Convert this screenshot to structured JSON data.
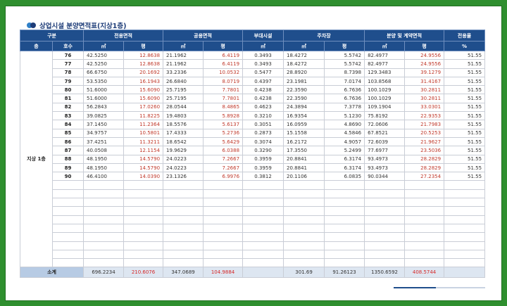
{
  "title": "상업시설 분양면적표(지상1층)",
  "headers": {
    "group": "구분",
    "exclusive": "전용면적",
    "common": "공용면적",
    "auxiliary": "부대시설",
    "parking": "주차장",
    "contract": "분양 및 계약면적",
    "ratio": "전용율",
    "floor": "층",
    "unit_no": "호수",
    "sqm": "㎡",
    "pyeong": "평",
    "percent": "%"
  },
  "floor_label": "지상 1층",
  "rows": [
    {
      "unit": "76",
      "ex_m": "42.5250",
      "ex_p": "12.8638",
      "co_m": "21.1962",
      "co_p": "6.4119",
      "aux": "0.3493",
      "pk_m": "18.4272",
      "pk_p": "5.5742",
      "ct_m": "82.4977",
      "ct_p": "24.9556",
      "ratio": "51.55"
    },
    {
      "unit": "77",
      "ex_m": "42.5250",
      "ex_p": "12.8638",
      "co_m": "21.1962",
      "co_p": "6.4119",
      "aux": "0.3493",
      "pk_m": "18.4272",
      "pk_p": "5.5742",
      "ct_m": "82.4977",
      "ct_p": "24.9556",
      "ratio": "51.55"
    },
    {
      "unit": "78",
      "ex_m": "66.6750",
      "ex_p": "20.1692",
      "co_m": "33.2336",
      "co_p": "10.0532",
      "aux": "0.5477",
      "pk_m": "28.8920",
      "pk_p": "8.7398",
      "ct_m": "129.3483",
      "ct_p": "39.1279",
      "ratio": "51.55"
    },
    {
      "unit": "79",
      "ex_m": "53.5350",
      "ex_p": "16.1943",
      "co_m": "26.6840",
      "co_p": "8.0719",
      "aux": "0.4397",
      "pk_m": "23.1981",
      "pk_p": "7.0174",
      "ct_m": "103.8568",
      "ct_p": "31.4167",
      "ratio": "51.55"
    },
    {
      "unit": "80",
      "ex_m": "51.6000",
      "ex_p": "15.6090",
      "co_m": "25.7195",
      "co_p": "7.7801",
      "aux": "0.4238",
      "pk_m": "22.3590",
      "pk_p": "6.7636",
      "ct_m": "100.1029",
      "ct_p": "30.2811",
      "ratio": "51.55"
    },
    {
      "unit": "81",
      "ex_m": "51.6000",
      "ex_p": "15.6090",
      "co_m": "25.7195",
      "co_p": "7.7801",
      "aux": "0.4238",
      "pk_m": "22.3590",
      "pk_p": "6.7636",
      "ct_m": "100.1029",
      "ct_p": "30.2811",
      "ratio": "51.55"
    },
    {
      "unit": "82",
      "ex_m": "56.2843",
      "ex_p": "17.0260",
      "co_m": "28.0544",
      "co_p": "8.4865",
      "aux": "0.4623",
      "pk_m": "24.3894",
      "pk_p": "7.3778",
      "ct_m": "109.1904",
      "ct_p": "33.0301",
      "ratio": "51.55"
    },
    {
      "unit": "83",
      "ex_m": "39.0825",
      "ex_p": "11.8225",
      "co_m": "19.4803",
      "co_p": "5.8928",
      "aux": "0.3210",
      "pk_m": "16.9354",
      "pk_p": "5.1230",
      "ct_m": "75.8192",
      "ct_p": "22.9353",
      "ratio": "51.55"
    },
    {
      "unit": "84",
      "ex_m": "37.1450",
      "ex_p": "11.2364",
      "co_m": "18.5576",
      "co_p": "5.6137",
      "aux": "0.3051",
      "pk_m": "16.0959",
      "pk_p": "4.8690",
      "ct_m": "72.0606",
      "ct_p": "21.7983",
      "ratio": "51.55"
    },
    {
      "unit": "85",
      "ex_m": "34.9757",
      "ex_p": "10.5801",
      "co_m": "17.4333",
      "co_p": "5.2736",
      "aux": "0.2873",
      "pk_m": "15.1558",
      "pk_p": "4.5846",
      "ct_m": "67.8521",
      "ct_p": "20.5253",
      "ratio": "51.55"
    },
    {
      "unit": "86",
      "ex_m": "37.4251",
      "ex_p": "11.3211",
      "co_m": "18.6542",
      "co_p": "5.6429",
      "aux": "0.3074",
      "pk_m": "16.2172",
      "pk_p": "4.9057",
      "ct_m": "72.6039",
      "ct_p": "21.9627",
      "ratio": "51.55"
    },
    {
      "unit": "87",
      "ex_m": "40.0508",
      "ex_p": "12.1154",
      "co_m": "19.9629",
      "co_p": "6.0388",
      "aux": "0.3290",
      "pk_m": "17.3550",
      "pk_p": "5.2499",
      "ct_m": "77.6977",
      "ct_p": "23.5036",
      "ratio": "51.55"
    },
    {
      "unit": "88",
      "ex_m": "48.1950",
      "ex_p": "14.5790",
      "co_m": "24.0223",
      "co_p": "7.2667",
      "aux": "0.3959",
      "pk_m": "20.8841",
      "pk_p": "6.3174",
      "ct_m": "93.4973",
      "ct_p": "28.2829",
      "ratio": "51.55"
    },
    {
      "unit": "89",
      "ex_m": "48.1950",
      "ex_p": "14.5790",
      "co_m": "24.0223",
      "co_p": "7.2667",
      "aux": "0.3959",
      "pk_m": "20.8841",
      "pk_p": "6.3174",
      "ct_m": "93.4973",
      "ct_p": "28.2829",
      "ratio": "51.55"
    },
    {
      "unit": "90",
      "ex_m": "46.4100",
      "ex_p": "14.0390",
      "co_m": "23.1326",
      "co_p": "6.9976",
      "aux": "0.3812",
      "pk_m": "20.1106",
      "pk_p": "6.0835",
      "ct_m": "90.0344",
      "ct_p": "27.2354",
      "ratio": "51.55"
    }
  ],
  "total": {
    "label": "소계",
    "ex_m": "696.2234",
    "ex_p": "210.6076",
    "co_m": "347.0689",
    "co_p": "104.9884",
    "aux": "",
    "pk_m": "301.69",
    "pk_p": "91.26123",
    "ct_m": "1350.6592",
    "ct_p": "408.5744",
    "ratio": ""
  },
  "colors": {
    "header_bg": "#1f4e8c",
    "pyeong_text": "#c0392b",
    "frame": "#2f8f2f",
    "total_bg": "#dde6f1"
  }
}
